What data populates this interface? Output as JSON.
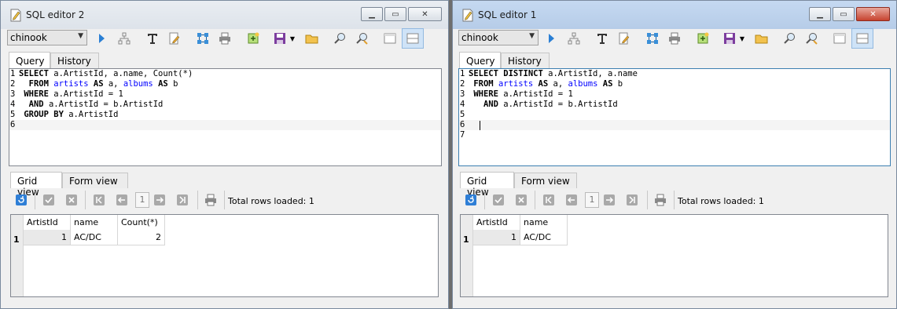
{
  "windows": [
    {
      "title": "SQL editor 2",
      "database": "chinook",
      "query_tabs": [
        "Query",
        "History"
      ],
      "code_lines": [
        {
          "n": "1",
          "parts": [
            [
              "kw",
              "SELECT"
            ],
            [
              "t",
              " a.ArtistId, a.name, Count(*)"
            ]
          ]
        },
        {
          "n": "2",
          "parts": [
            [
              "t",
              "  "
            ],
            [
              "kw",
              "FROM"
            ],
            [
              "t",
              " "
            ],
            [
              "tbl",
              "artists"
            ],
            [
              "t",
              " "
            ],
            [
              "kw",
              "AS"
            ],
            [
              "t",
              " a, "
            ],
            [
              "tbl",
              "albums"
            ],
            [
              "t",
              " "
            ],
            [
              "kw",
              "AS"
            ],
            [
              "t",
              " b"
            ]
          ]
        },
        {
          "n": "3",
          "parts": [
            [
              "t",
              " "
            ],
            [
              "kw",
              "WHERE"
            ],
            [
              "t",
              " a.ArtistId = 1"
            ]
          ]
        },
        {
          "n": "4",
          "parts": [
            [
              "t",
              "  "
            ],
            [
              "kw",
              "AND"
            ],
            [
              "t",
              " a.ArtistId = b.ArtistId"
            ]
          ]
        },
        {
          "n": "5",
          "parts": [
            [
              "t",
              " "
            ],
            [
              "kw",
              "GROUP BY"
            ],
            [
              "t",
              " a.ArtistId"
            ]
          ]
        },
        {
          "n": "6",
          "parts": []
        }
      ],
      "result_tabs": [
        "Grid view",
        "Form view"
      ],
      "page": "1",
      "total_rows": "Total rows loaded: 1",
      "columns": [
        "ArtistId",
        "name",
        "Count(*)"
      ],
      "rows": [
        {
          "n": "1",
          "cells": [
            "1",
            "AC/DC",
            "2"
          ]
        }
      ]
    },
    {
      "title": "SQL editor 1",
      "database": "chinook",
      "query_tabs": [
        "Query",
        "History"
      ],
      "code_lines": [
        {
          "n": "1",
          "parts": [
            [
              "kw",
              "SELECT DISTINCT"
            ],
            [
              "t",
              " a.ArtistId, a.name"
            ]
          ]
        },
        {
          "n": "2",
          "parts": [
            [
              "t",
              " "
            ],
            [
              "kw",
              "FROM"
            ],
            [
              "t",
              " "
            ],
            [
              "tbl",
              "artists"
            ],
            [
              "t",
              " "
            ],
            [
              "kw",
              "AS"
            ],
            [
              "t",
              " a, "
            ],
            [
              "tbl",
              "albums"
            ],
            [
              "t",
              " "
            ],
            [
              "kw",
              "AS"
            ],
            [
              "t",
              " b"
            ]
          ]
        },
        {
          "n": "3",
          "parts": [
            [
              "t",
              " "
            ],
            [
              "kw",
              "WHERE"
            ],
            [
              "t",
              " a.ArtistId = 1"
            ]
          ]
        },
        {
          "n": "4",
          "parts": [
            [
              "t",
              "   "
            ],
            [
              "kw",
              "AND"
            ],
            [
              "t",
              " a.ArtistId = b.ArtistId"
            ]
          ]
        },
        {
          "n": "5",
          "parts": []
        },
        {
          "n": "6",
          "parts": []
        },
        {
          "n": "7",
          "parts": []
        }
      ],
      "result_tabs": [
        "Grid view",
        "Form view"
      ],
      "page": "1",
      "total_rows": "Total rows loaded: 1",
      "columns": [
        "ArtistId",
        "name"
      ],
      "rows": [
        {
          "n": "1",
          "cells": [
            "1",
            "AC/DC"
          ]
        }
      ]
    }
  ]
}
